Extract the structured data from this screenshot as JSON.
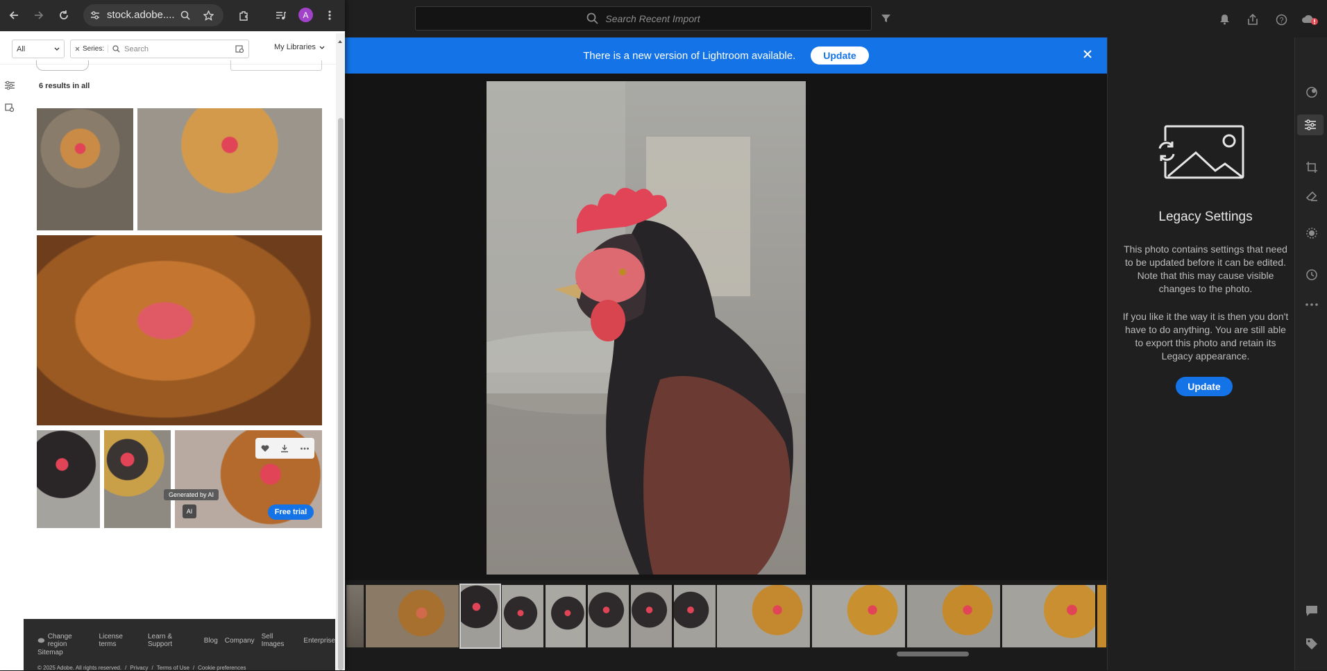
{
  "browser": {
    "url": "stock.adobe....",
    "avatar_initial": "A"
  },
  "stock": {
    "filter_all": "All",
    "series_label": "Series:",
    "search_placeholder": "Search",
    "my_libraries": "My Libraries",
    "results_count": "6 results in all",
    "generated_by_ai": "Generated by AI",
    "ai_badge": "AI",
    "free_trial": "Free trial",
    "footer_links": [
      "Change region",
      "License terms",
      "Learn & Support",
      "Blog",
      "Company",
      "Sell Images",
      "Enterprise"
    ],
    "footer_sitemap": "Sitemap",
    "footer_copyright": "© 2025 Adobe. All rights reserved.",
    "footer_bottom_links": [
      "Privacy",
      "Terms of Use",
      "Cookie preferences"
    ]
  },
  "lightroom": {
    "search_placeholder": "Search Recent Import",
    "banner_text": "There is a new version of Lightroom available.",
    "banner_update": "Update",
    "legacy_title": "Legacy Settings",
    "legacy_para1": "This photo contains settings that need to be updated before it can be edited. Note that this may cause visible changes to the photo.",
    "legacy_para2": "If you like it the way it is then you don't have to do anything. You are still able to export this photo and retain its Legacy appearance.",
    "legacy_update": "Update"
  },
  "colors": {
    "accent": "#1473e6",
    "notification": "#e34850"
  }
}
